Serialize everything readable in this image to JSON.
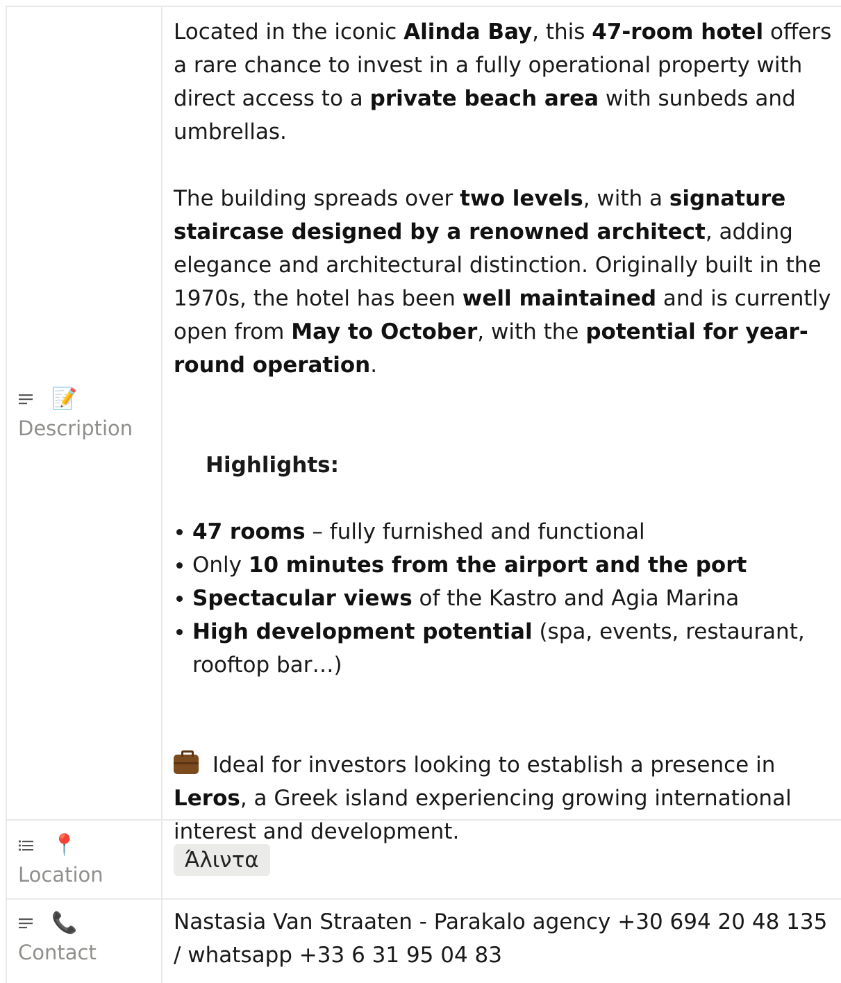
{
  "properties": [
    {
      "label": "Description",
      "type_icon": "text-lines-icon",
      "emoji": "📝",
      "emoji_name": "memo-icon"
    },
    {
      "label": "Location",
      "type_icon": "bulleted-list-icon",
      "emoji": "📍",
      "emoji_name": "round-pushpin-icon"
    },
    {
      "label": "Contact",
      "type_icon": "text-lines-icon",
      "emoji": "📞",
      "emoji_name": "telephone-receiver-icon"
    }
  ],
  "description": {
    "p1": {
      "t1": "Located in the iconic ",
      "b1": "Alinda Bay",
      "t2": ", this ",
      "b2": "47-room hotel",
      "t3": " offers a rare chance to invest in a fully operational property with direct access to a ",
      "b3": "private beach area",
      "t4": " with sunbeds and umbrellas."
    },
    "p2": {
      "t1": "The building spreads over ",
      "b1": "two levels",
      "t2": ", with a ",
      "b2": "signature staircase designed by a renowned architect",
      "t3": ", adding elegance and architectural distinction. Originally built in the 1970s, the hotel has been ",
      "b3": "well maintained",
      "t4": " and is currently open from ",
      "b4": "May to October",
      "t5": ", with the ",
      "b5": "potential for year-round operation",
      "t6": "."
    },
    "highlights_title": "Highlights:",
    "highlights": [
      {
        "bold": "47 rooms",
        "rest": " – fully furnished and functional",
        "pre": ""
      },
      {
        "pre": "Only ",
        "bold": "10 minutes from the airport and the port",
        "rest": ""
      },
      {
        "pre": "",
        "bold": "Spectacular views",
        "rest": " of the Kastro and Agia Marina"
      },
      {
        "pre": "",
        "bold": "High development potential",
        "rest": " (spa, events, restaurant, rooftop bar…)"
      }
    ],
    "p3": {
      "icon": "briefcase-icon",
      "t1": " Ideal for investors looking to establish a presence in ",
      "b1": "Leros",
      "t2": ", a Greek island experiencing growing international interest and development."
    }
  },
  "location": {
    "tag": "Άλιντα"
  },
  "contact": {
    "text": "Nastasia Van Straaten - Parakalo agency +30 694 20 48 135 / whatsapp +33 6 31 95 04 83"
  }
}
